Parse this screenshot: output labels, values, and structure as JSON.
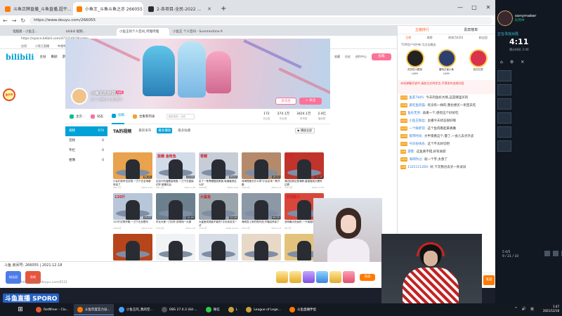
{
  "outer_browser": {
    "tabs": [
      {
        "title": "斗鱼正牌直播_斗鱼直播,超干...",
        "active": false
      },
      {
        "title": "小鱼王_斗鱼斗鱼之亦 266055",
        "active": true
      },
      {
        "title": "2-各项目-全民-2022 ...",
        "active": false
      }
    ],
    "url": "https://www.douyu.com/266055",
    "window_controls": [
      "—",
      "□",
      "✕"
    ]
  },
  "inner_browser": {
    "tabs": [
      {
        "title": "电脑版 - 小鱼王...",
        "active": false
      },
      {
        "title": "bilibili 视频...",
        "active": false
      },
      {
        "title": "小鱼王的个人空间_哔哩哔哩",
        "active": true
      },
      {
        "title": "小鱼王 个人空间 - Summertime Ma...",
        "active": false
      }
    ],
    "url": "https://space.bilibili.com/473314619/video",
    "bookmarks": [
      "应用",
      "小鱼王直播",
      "哔哩哔哩",
      "bilibili",
      "斗鱼",
      "直播间",
      "百度",
      "AppleAPP",
      "Hot News",
      "Steam",
      "Blog"
    ]
  },
  "bili_header": {
    "logo": "bilibili",
    "nav": [
      "主站",
      "番剧",
      "游戏中心",
      "直播",
      "会员购",
      "漫画",
      "赛事",
      "下载APP"
    ],
    "search_placeholder": "大家都在搜: 小鱼王家的日常",
    "right_nav": [
      "大会员",
      "消息",
      "动态",
      "收藏",
      "历史",
      "创作中心"
    ],
    "upload": "投稿"
  },
  "profile": {
    "name": "小鱼王的后花园",
    "level": "LV6",
    "sign": "这个人很懒,什么都没有写",
    "message_button": "发消息",
    "follow_button": "+ 关注"
  },
  "space_nav": {
    "tabs": [
      {
        "label": "主页",
        "active": false
      },
      {
        "label": "动态",
        "active": false
      },
      {
        "label": "投稿",
        "active": true
      },
      {
        "label": "合集和列表",
        "active": false
      }
    ],
    "search_placeholder": "搜索视频、动态",
    "stats": [
      {
        "label": "关注数",
        "value": "172"
      },
      {
        "label": "粉丝数",
        "value": "274.1万"
      },
      {
        "label": "获赞数",
        "value": "3424.1万"
      },
      {
        "label": "播放数",
        "value": "2.4亿"
      }
    ]
  },
  "left_side": {
    "items": [
      {
        "label": "视频",
        "count": "674",
        "active": true
      },
      {
        "label": "音频",
        "count": "0",
        "active": false
      },
      {
        "label": "专栏",
        "count": "0",
        "active": false
      },
      {
        "label": "相簿",
        "count": "0",
        "active": false
      }
    ]
  },
  "videos": {
    "title": "TA的视频",
    "filters": [
      {
        "label": "最新发布",
        "active": false
      },
      {
        "label": "最多播放",
        "active": true
      },
      {
        "label": "最多收藏",
        "active": false
      }
    ],
    "play_all": "▶ 播放全部",
    "cards": [
      {
        "caption": "",
        "title": "小伙钓到罕见巨物,一刀下去全场都惊呆了",
        "views": "392.7万",
        "date": "2021-3-15",
        "duration": "08:21",
        "bg": "#e9a24d"
      },
      {
        "caption": "蓝鳍 金枪鱼",
        "title": "近百斤的蓝鳍金枪鱼,一刀下去直接切开,鲜嫩无比",
        "views": "201.2万",
        "date": "2021-1-20",
        "duration": "12:05",
        "bg": "#d2dbe8"
      },
      {
        "caption": "青鳗",
        "title": "买了一条青鳗做成美食,味道竟然这么好",
        "views": "156.8万",
        "date": "2020-12-8",
        "duration": "09:47",
        "bg": "#c6cdd6"
      },
      {
        "caption": "",
        "title": "深海怪鱼长什么样?小伙买来一条开箱",
        "views": "144.3万",
        "date": "2021-2-2",
        "duration": "10:12",
        "bg": "#b58a6a"
      },
      {
        "caption": "巨型",
        "title": "海边捡到巨型海鲜,直接做成大餐吃过瘾",
        "views": "132.9万",
        "date": "2020-11-30",
        "duration": "11:33",
        "bg": "#c0342b"
      },
      {
        "caption": "120斤",
        "title": "120斤巨物开箱,一刀下去全是肉",
        "views": "128.4万",
        "date": "2021-4-11",
        "duration": "13:02",
        "bg": "#b7c7d9"
      },
      {
        "caption": "",
        "title": "东北大鱼一刀切开,现场炖一大锅",
        "views": "119.6万",
        "date": "2021-1-8",
        "duration": "10:40",
        "bg": "#6b7f8c"
      },
      {
        "caption": "大鲨鱼",
        "title": "大鲨鱼到底能不能吃?今天亲自试一试",
        "views": "110.2万",
        "date": "2020-10-21",
        "duration": "12:18",
        "bg": "#9aa4ab"
      },
      {
        "caption": "",
        "title": "海底捞上来的怪东西,开箱后惊呆了",
        "views": "101.5万",
        "date": "2021-3-3",
        "duration": "09:55",
        "bg": "#8c98a6"
      },
      {
        "caption": "全网最大",
        "title": "全网最大的龙虾,一只就能吃饱",
        "views": "98.7万",
        "date": "2021-2-26",
        "duration": "11:09",
        "bg": "#d8473b"
      },
      {
        "caption": "",
        "title": "",
        "views": "",
        "date": "",
        "duration": "",
        "bg": "#b6451c"
      },
      {
        "caption": "",
        "title": "",
        "views": "",
        "date": "",
        "duration": "",
        "bg": "#f1f2f4"
      },
      {
        "caption": "",
        "title": "",
        "views": "",
        "date": "",
        "duration": "",
        "bg": "#d6dde6"
      },
      {
        "caption": "",
        "title": "",
        "views": "",
        "date": "",
        "duration": "",
        "bg": "#e7d8c7"
      },
      {
        "caption": "",
        "title": "",
        "views": "",
        "date": "",
        "duration": "",
        "bg": "#e3c37c"
      }
    ]
  },
  "stream": {
    "room_line": "斗鱼 房间号: 266055 | 2021.12.18",
    "left_buttons": [
      "粉丝团",
      "鱼吧"
    ],
    "room_link": "https://www.douyu.com/6531",
    "charge": "充值"
  },
  "floating_logo": "鱼乐节",
  "chat": {
    "tabs": [
      {
        "label": "主播排行",
        "active": true
      },
      {
        "label": "贵宾榜单",
        "active": false
      }
    ],
    "sub_tabs": [
      {
        "label": "日榜",
        "active": true
      },
      {
        "label": "周榜",
        "active": false
      },
      {
        "label": "贵宾(5420)",
        "active": false
      },
      {
        "label": "粉丝团",
        "active": false
      }
    ],
    "fans_title": "TOP用户守护神 可点击赠送",
    "fans": [
      {
        "name": "苏苏的小跟班",
        "level": "LV99"
      },
      {
        "name": "雷鸣王者小鱼",
        "level": "LV99"
      },
      {
        "name": "告白礼物",
        "level": ""
      }
    ],
    "notice": "本场弹幕开放中,请各位文明发言,不得发布违规内容",
    "messages": [
      {
        "level": "LV12",
        "user": "鱼友7845:",
        "text": "今天的鱼好大啊,这是哪里买的"
      },
      {
        "level": "LV18",
        "user": "爱吃鱼的猫:",
        "text": "有没有一样的,我也想买一条回去吃"
      },
      {
        "level": "LV9",
        "user": "鱼乐无穷:",
        "text": "再来一个,感觉这个好好吃"
      },
      {
        "level": "LV22",
        "user": "小鱼王粉丝:",
        "text": "主播今天状态很好啊"
      },
      {
        "level": "LV15",
        "user": "一个鲜虾饺:",
        "text": "这个鱼肉看起来真嫩"
      },
      {
        "level": "LV30",
        "user": "夜宵时间:",
        "text": "大半夜看这个,饿了,一会儿去点外卖"
      },
      {
        "level": "LV11",
        "user": "今日份快乐:",
        "text": "这个不太好切吧"
      },
      {
        "level": "LV8",
        "user": "游客:",
        "text": "这鱼真不错,好有食欲"
      },
      {
        "level": "LV25",
        "user": "海风吹过:",
        "text": "就一个字,太香了"
      },
      {
        "level": "LV6",
        "user": "1325111260:",
        "text": "好,下次我也去买一条试试"
      }
    ],
    "send": "发送"
  },
  "game_panel": {
    "username": "sonymaker",
    "status": "队列中",
    "queue_label": "正在寻找对局",
    "timer": "4:11",
    "timer_sub": "预计时间: 2:40",
    "icons": [
      "⌂",
      "⚙",
      "✕"
    ],
    "bottom_text": [
      "5 0/5",
      "9 / 21 / 10"
    ]
  },
  "taskbar": {
    "items": [
      {
        "label": "RetMiner - Clo...",
        "color": "#e4572e",
        "active": false
      },
      {
        "label": "斗鱼年度实力派...",
        "color": "#ff7a00",
        "active": true
      },
      {
        "label": "小鱼王的_我的空...",
        "color": "#4aa3ff",
        "active": false
      },
      {
        "label": "OBS 27.0.3 (64-...",
        "color": "#555555",
        "active": false
      },
      {
        "label": "微信",
        "color": "#2ecc40",
        "active": false
      },
      {
        "label": "L",
        "color": "#c9a13a",
        "active": false
      },
      {
        "label": "League of Lege...",
        "color": "#c9a13a",
        "active": false
      },
      {
        "label": "斗鱼直播伴侣",
        "color": "#ff7a00",
        "active": false
      }
    ],
    "tray": [
      "^",
      "🔊",
      "英"
    ],
    "time": "1:47",
    "date": "2021/12/18"
  },
  "watermark": "斗鱼直播 SPORO"
}
